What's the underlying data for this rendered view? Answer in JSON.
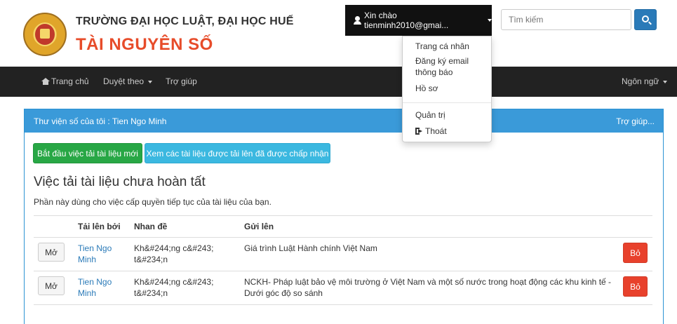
{
  "header": {
    "university_name": "TRƯỜNG ĐẠI HỌC LUẬT, ĐẠI HỌC HUẾ",
    "site_name": "TÀI NGUYÊN SỐ",
    "user_menu_label": "Xin chào tienminh2010@gmai...",
    "search_placeholder": "Tìm kiếm"
  },
  "navbar": {
    "home": "Trang chủ",
    "browse": "Duyệt theo",
    "help": "Trợ giúp",
    "language": "Ngôn ngữ"
  },
  "user_dropdown": {
    "items": [
      "Trang cá nhân",
      "Đăng ký email thông báo",
      "Hồ sơ",
      "Quản trị",
      "Thoát"
    ]
  },
  "panel": {
    "title": "Thư viện số của tôi : Tien Ngo Minh",
    "help_link": "Trợ giúp...",
    "start_button": "Bắt đầu việc tải tài liệu mới",
    "view_accepted_button": "Xem các tài liệu được tải lên đã được chấp nhận",
    "section_title": "Việc tải tài liệu chưa hoàn tất",
    "section_desc": "Phần này dùng cho việc cấp quyền tiếp tục của tài liệu của bạn."
  },
  "table": {
    "headers": [
      "",
      "Tải lên bởi",
      "Nhan đề",
      "Gửi lên",
      ""
    ],
    "rows": [
      {
        "open_label": "Mở",
        "uploader": "Tien Ngo Minh",
        "title": "Kh&#244;ng c&#243; t&#234;n",
        "submission": "Giá trình Luật Hành chính Việt Nam",
        "remove_label": "Bỏ"
      },
      {
        "open_label": "Mở",
        "uploader": "Tien Ngo Minh",
        "title": "Kh&#244;ng c&#243; t&#234;n",
        "submission": "NCKH- Pháp luật bảo vệ môi trường ở Việt Nam và một số nước trong hoạt động các khu kinh tế - Dưới góc độ so sánh",
        "remove_label": "Bỏ"
      }
    ]
  },
  "colors": {
    "navbar_bg": "#222222",
    "panel_primary": "#3a9ad9",
    "success": "#28a745",
    "info": "#3bb8e0",
    "danger": "#e8412c",
    "brand_red": "#e74c2a"
  }
}
